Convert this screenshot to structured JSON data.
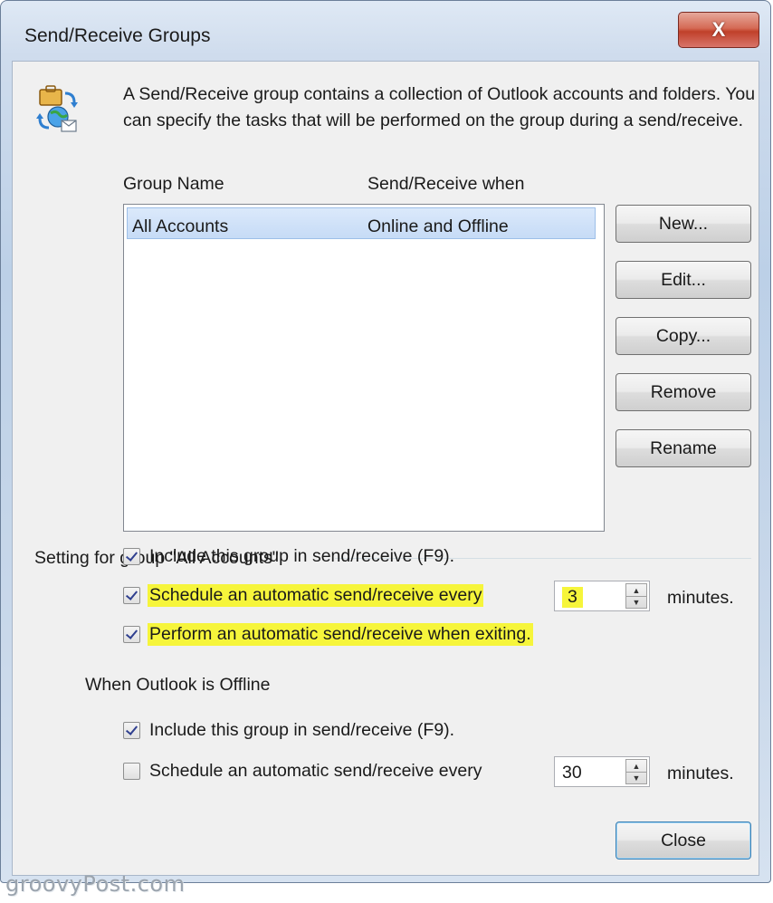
{
  "window": {
    "title": "Send/Receive Groups",
    "close_glyph": "X"
  },
  "description": "A Send/Receive group contains a collection of Outlook accounts and folders. You can specify the tasks that will be performed on the group during a send/receive.",
  "group_list": {
    "columns": [
      "Group Name",
      "Send/Receive when"
    ],
    "rows": [
      {
        "name": "All Accounts",
        "when": "Online and Offline",
        "selected": true
      }
    ]
  },
  "buttons": {
    "new": "New...",
    "edit": "Edit...",
    "copy": "Copy...",
    "remove": "Remove",
    "rename": "Rename",
    "close": "Close"
  },
  "settings": {
    "group_title": "Setting for group \"All Accounts\"",
    "online": {
      "include": {
        "label": "Include this group in send/receive (F9).",
        "checked": true
      },
      "schedule": {
        "label": "Schedule an automatic send/receive every",
        "checked": true,
        "value": "3",
        "unit": "minutes."
      },
      "exit": {
        "label": "Perform an automatic send/receive when exiting.",
        "checked": true
      }
    },
    "offline_title": "When Outlook is Offline",
    "offline": {
      "include": {
        "label": "Include this group in send/receive (F9).",
        "checked": true
      },
      "schedule": {
        "label": "Schedule an automatic send/receive every",
        "checked": false,
        "value": "30",
        "unit": "minutes."
      }
    }
  },
  "icons": {
    "header": "send-receive-groups-icon",
    "spin_up": "up-arrow-icon",
    "spin_down": "down-arrow-icon"
  },
  "highlight_color": "#f6f53b",
  "watermark": "groovyPost.com"
}
